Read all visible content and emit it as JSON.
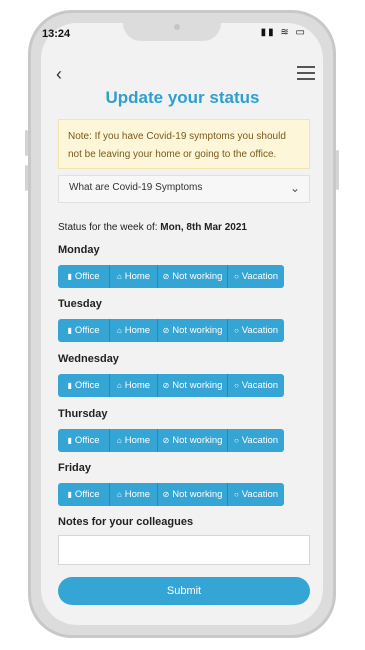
{
  "statusbar": {
    "time": "13:24",
    "icons": "▮▮ ≋ ▭"
  },
  "nav": {
    "back_icon": "‹"
  },
  "page": {
    "title": "Update your status",
    "note": "Note: If you have Covid-19 symptoms you should not be leaving your home or going to the office.",
    "symptoms_accordion": "What are Covid-19 Symptoms",
    "chevron_icon": "⌄",
    "week_label": "Status for the week of:",
    "week_value": "Mon, 8th Mar 2021"
  },
  "days": [
    {
      "name": "Monday"
    },
    {
      "name": "Tuesday"
    },
    {
      "name": "Wednesday"
    },
    {
      "name": "Thursday"
    },
    {
      "name": "Friday"
    }
  ],
  "options": [
    {
      "label": "Office",
      "icon": "▮",
      "icon_name": "building-icon"
    },
    {
      "label": "Home",
      "icon": "⌂",
      "icon_name": "home-icon"
    },
    {
      "label": "Not working",
      "icon": "⊘",
      "icon_name": "ban-icon"
    },
    {
      "label": "Vacation",
      "icon": "○",
      "icon_name": "sun-icon"
    }
  ],
  "notes": {
    "label": "Notes for your colleagues",
    "placeholder": ""
  },
  "submit_label": "Submit",
  "colors": {
    "accent": "#34a5d5",
    "title": "#2f9fcf",
    "note_bg": "#fdf6d8"
  }
}
